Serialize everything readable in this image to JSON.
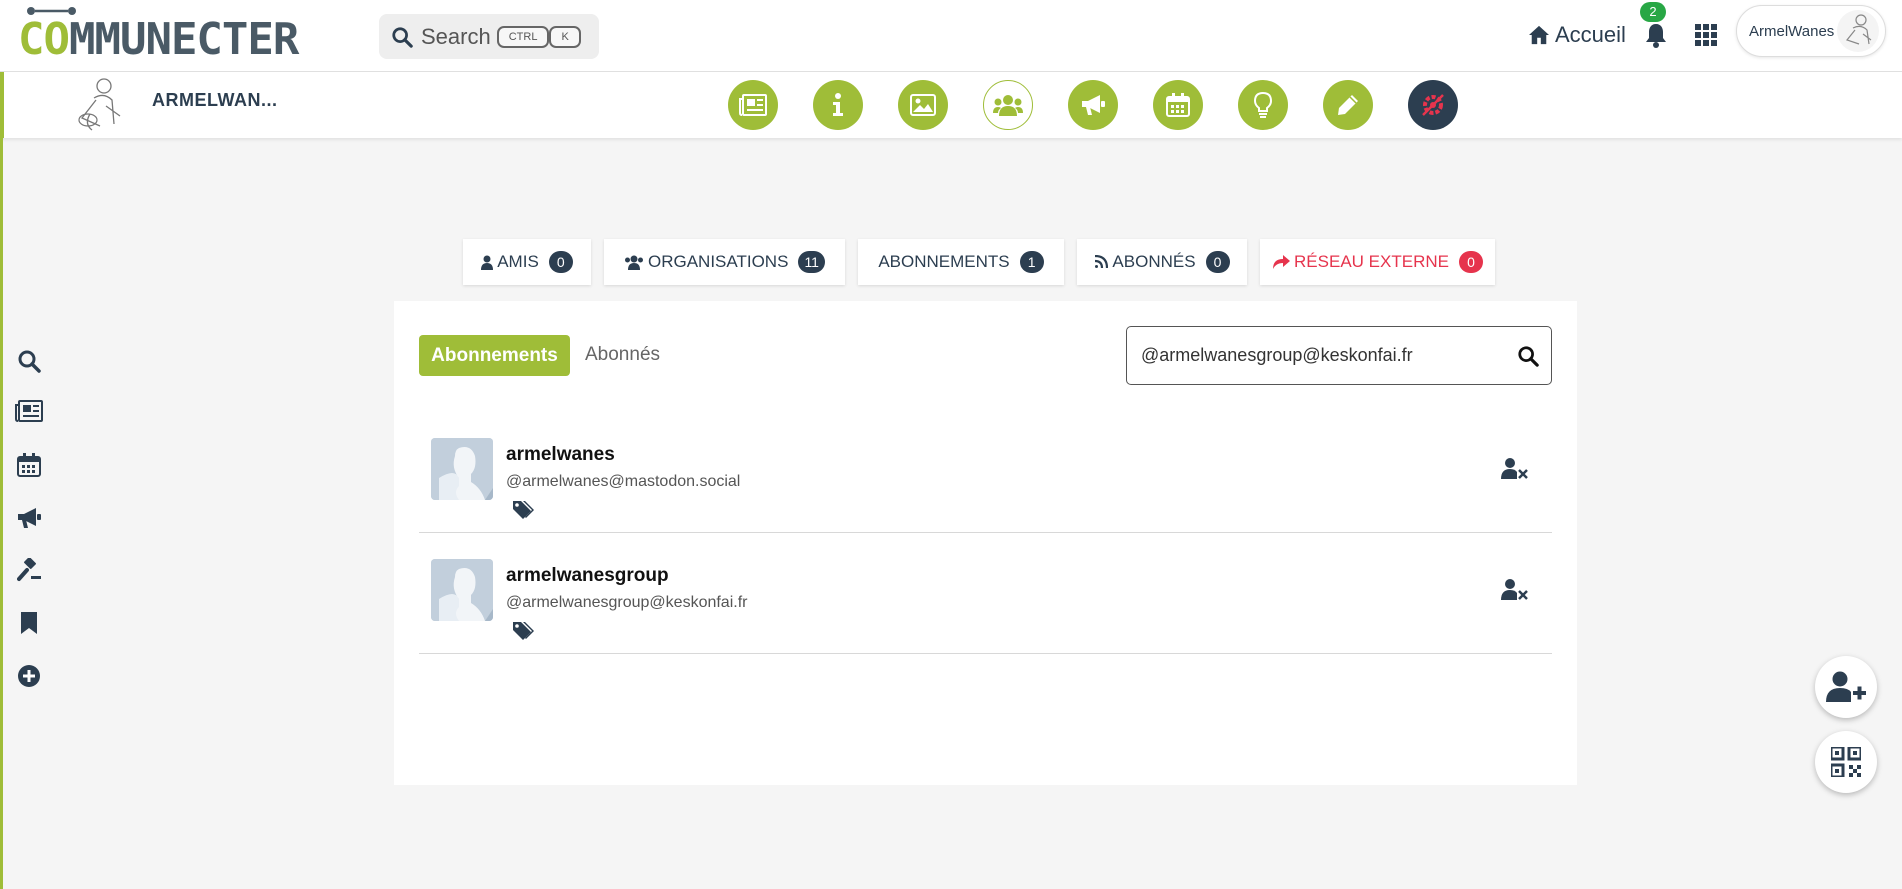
{
  "header": {
    "logo_prefix": "CO",
    "logo_rest": "MMUNECTER",
    "search_label": "Search",
    "search_keys": [
      "CTRL",
      "K"
    ],
    "home_label": "Accueil",
    "notifications_count": "2",
    "user_name": "ArmelWanes"
  },
  "profile": {
    "name": "ARMELWAN...",
    "nav_icons": [
      "newspaper-icon",
      "info-icon",
      "image-icon",
      "community-icon",
      "megaphone-icon",
      "calendar-icon",
      "lightbulb-icon",
      "pencil-icon",
      "gear-icon"
    ],
    "active_nav": "community-icon"
  },
  "sidebar": {
    "icons": [
      "search-icon",
      "newspaper-icon",
      "calendar-icon",
      "megaphone-icon",
      "gavel-icon",
      "bookmark-icon",
      "plus-circle-icon"
    ]
  },
  "tabs": [
    {
      "label": "AMIS",
      "count": "0",
      "icon": "user-icon"
    },
    {
      "label": "ORGANISATIONS",
      "count": "11",
      "icon": "users-icon"
    },
    {
      "label": "ABONNEMENTS",
      "count": "1",
      "icon": ""
    },
    {
      "label": "ABONNÉS",
      "count": "0",
      "icon": "rss-icon"
    },
    {
      "label": "RÉSEAU EXTERNE",
      "count": "0",
      "icon": "share-icon"
    }
  ],
  "panel": {
    "active_button": "Abonnements",
    "other_link": "Abonnés",
    "search_value": "@armelwanesgroup@keskonfai.fr",
    "items": [
      {
        "name": "armelwanes",
        "handle": "@armelwanes@mastodon.social"
      },
      {
        "name": "armelwanesgroup",
        "handle": "@armelwanesgroup@keskonfai.fr"
      }
    ]
  },
  "colors": {
    "brand_green": "#9fbd38",
    "dark": "#2c3e50",
    "red": "#e6344d",
    "notif_green": "#28a745"
  }
}
